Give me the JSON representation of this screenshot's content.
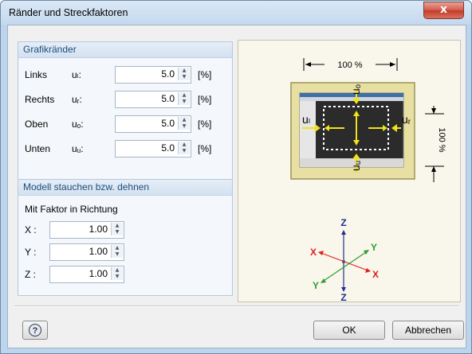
{
  "window": {
    "title": "Ränder und Streckfaktoren",
    "close_label": "x"
  },
  "margins": {
    "header": "Grafikränder",
    "unit": "[%]",
    "rows": [
      {
        "label": "Links",
        "symbol": "uₗ:",
        "value": "5.0"
      },
      {
        "label": "Rechts",
        "symbol": "uᵣ:",
        "value": "5.0"
      },
      {
        "label": "Oben",
        "symbol": "uₒ:",
        "value": "5.0"
      },
      {
        "label": "Unten",
        "symbol": "uᵤ:",
        "value": "5.0"
      }
    ]
  },
  "scale": {
    "header": "Modell stauchen bzw. dehnen",
    "subtitle": "Mit Faktor in Richtung",
    "rows": [
      {
        "label": "X :",
        "value": "1.00"
      },
      {
        "label": "Y :",
        "value": "1.00"
      },
      {
        "label": "Z :",
        "value": "1.00"
      }
    ]
  },
  "preview": {
    "width_label": "100 %",
    "height_label": "100 %",
    "u_top": "uₒ",
    "u_bottom": "uᵤ",
    "u_left": "uₗ",
    "u_right": "uᵣ",
    "axis_z_top": "Z",
    "axis_z_bottom": "Z",
    "axis_x_left": "X",
    "axis_x_right": "X",
    "axis_y_left": "Y",
    "axis_y_right": "Y",
    "colors": {
      "frame": "#e8e0a3",
      "screen": "#2b2b2b",
      "arrow": "#f1e21a",
      "x_axis": "#e02020",
      "y_axis": "#2ca02c",
      "z_axis": "#1f2f8f"
    }
  },
  "buttons": {
    "ok": "OK",
    "cancel": "Abbrechen",
    "help_icon": "help-icon"
  }
}
